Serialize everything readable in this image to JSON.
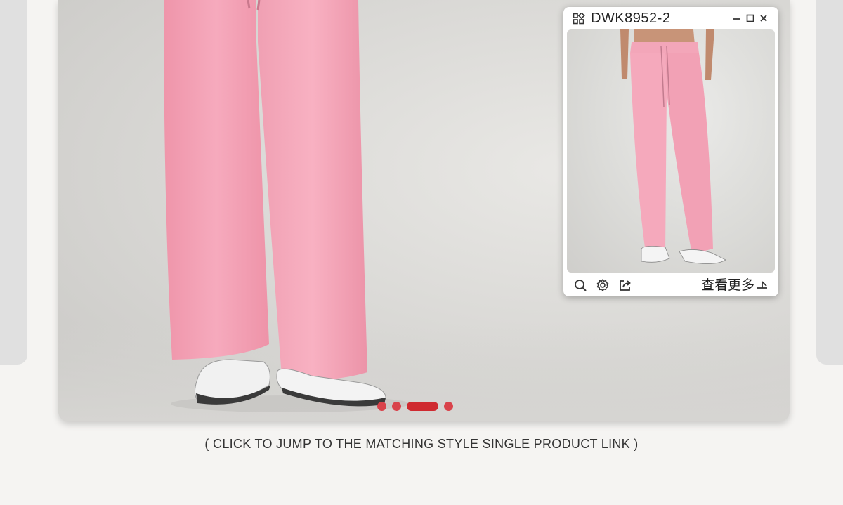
{
  "popup": {
    "title": "DWK8952-2",
    "view_more_label": "查看更多",
    "icons": [
      "grid-icon",
      "minimize-icon",
      "maximize-icon",
      "close-icon",
      "zoom-icon",
      "settings-icon",
      "share-icon",
      "arrow-icon"
    ]
  },
  "carousel": {
    "slide_count": 4,
    "active_index": 2
  },
  "caption": "( CLICK TO JUMP TO THE MATCHING STYLE SINGLE PRODUCT LINK )",
  "colors": {
    "accent_red": "#cf2a30",
    "pants_pink": "#f4a3b5",
    "background": "#f5f4f2"
  }
}
